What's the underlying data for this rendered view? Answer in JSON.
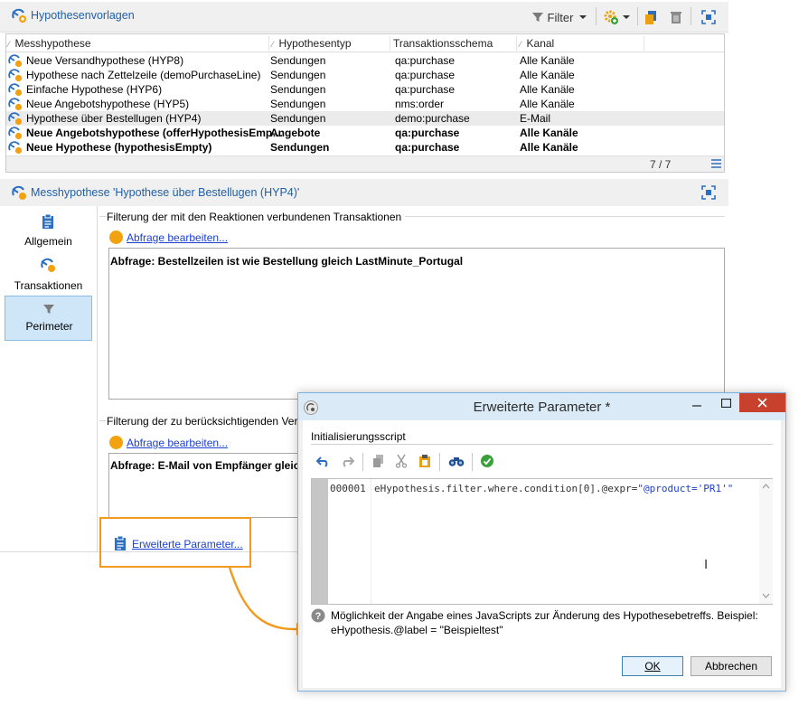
{
  "top_panel": {
    "title": "Hypothesenvorlagen",
    "filter_label": "Filter",
    "columns": [
      "Messhypothese",
      "Hypothesentyp",
      "Transaktionsschema",
      "Kanal"
    ],
    "rows": [
      {
        "name": "Neue Versandhypothese (HYP8)",
        "type": "Sendungen",
        "schema": "qa:purchase",
        "channel": "Alle Kanäle",
        "bold": false,
        "selected": false
      },
      {
        "name": "Hypothese nach Zettelzeile (demoPurchaseLine)",
        "type": "Sendungen",
        "schema": "qa:purchase",
        "channel": "Alle Kanäle",
        "bold": false,
        "selected": false
      },
      {
        "name": "Einfache Hypothese (HYP6)",
        "type": "Sendungen",
        "schema": "qa:purchase",
        "channel": "Alle Kanäle",
        "bold": false,
        "selected": false
      },
      {
        "name": "Neue Angebotshypothese (HYP5)",
        "type": "Sendungen",
        "schema": "nms:order",
        "channel": "Alle Kanäle",
        "bold": false,
        "selected": false
      },
      {
        "name": "Hypothese über Bestellugen (HYP4)",
        "type": "Sendungen",
        "schema": "demo:purchase",
        "channel": "E-Mail",
        "bold": false,
        "selected": true
      },
      {
        "name": "Neue Angebotshypothese (offerHypothesisEmp…",
        "type": "Angebote",
        "schema": "qa:purchase",
        "channel": "Alle Kanäle",
        "bold": true,
        "selected": false
      },
      {
        "name": "Neue Hypothese (hypothesisEmpty)",
        "type": "Sendungen",
        "schema": "qa:purchase",
        "channel": "Alle Kanäle",
        "bold": true,
        "selected": false
      }
    ],
    "count": "7 / 7"
  },
  "detail": {
    "title": "Messhypothese 'Hypothese über Bestellugen (HYP4)'",
    "nav": [
      {
        "label": "Allgemein",
        "icon": "clipboard-icon",
        "active": false
      },
      {
        "label": "Transaktionen",
        "icon": "hypothesis-icon",
        "active": false
      },
      {
        "label": "Perimeter",
        "icon": "funnel-icon",
        "active": true
      }
    ],
    "section1": {
      "title": "Filterung der mit den Reaktionen verbundenen Transaktionen",
      "link": "Abfrage bearbeiten...",
      "query": "Abfrage: Bestellzeilen ist wie Bestellung gleich LastMinute_Portugal"
    },
    "section2": {
      "title": "Filterung der zu berücksichtigenden Ver",
      "link": "Abfrage bearbeiten...",
      "query": "Abfrage: E-Mail von Empfänger gleich"
    },
    "advanced_link": "Erweiterte Parameter..."
  },
  "dialog": {
    "title": "Erweiterte Parameter *",
    "section_title": "Initialisierungsscript",
    "line_number": "000001",
    "code_prefix": "eHypothesis.filter.where.condition[0].@expr=",
    "code_string": "\"@product='PR1'\"",
    "help_line1": "Möglichkeit der Angabe eines JavaScripts zur Änderung des Hypothesebetreffs. Beispiel:",
    "help_line2": "eHypothesis.@label = \"Beispieltest\"",
    "ok_label": "OK",
    "cancel_label": "Abbrechen"
  },
  "colors": {
    "accent_blue": "#1f5fa8",
    "highlight_orange": "#f39a1e",
    "close_red": "#c7412d"
  }
}
